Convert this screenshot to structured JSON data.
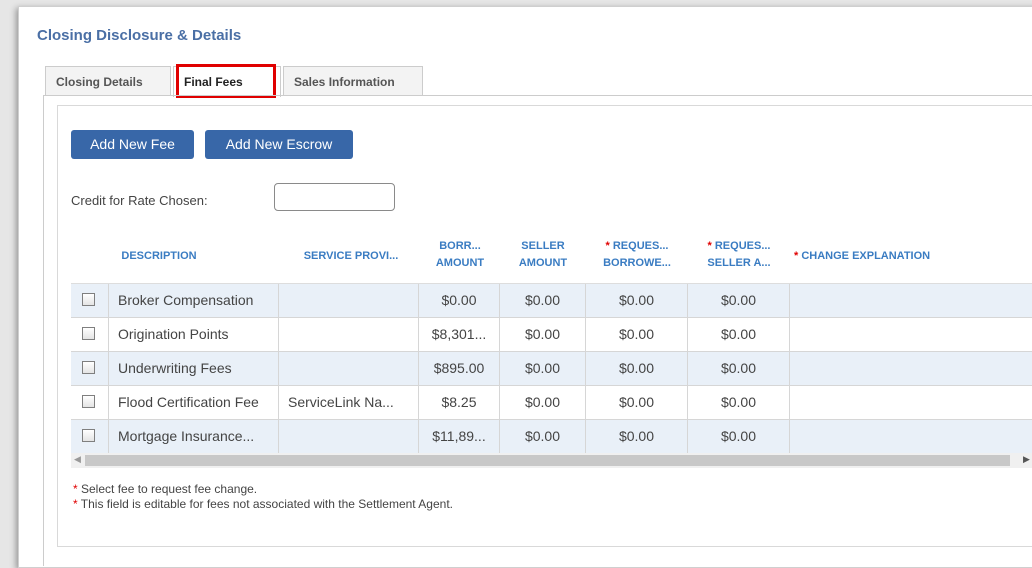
{
  "title": "Closing Disclosure & Details",
  "tabs": [
    {
      "label": "Closing Details"
    },
    {
      "label": "Final Fees"
    },
    {
      "label": "Sales Information"
    }
  ],
  "buttons": {
    "add_fee": "Add New Fee",
    "add_escrow": "Add New Escrow"
  },
  "credit": {
    "label": "Credit for Rate Chosen:",
    "value": ""
  },
  "columns": {
    "description": "DESCRIPTION",
    "service_provider": "SERVICE PROVI...",
    "borrower_amount_1": "BORR...",
    "borrower_amount_2": "AMOUNT",
    "seller_amount_1": "SELLER",
    "seller_amount_2": "AMOUNT",
    "req_borrower_1": "REQUES...",
    "req_borrower_2": "BORROWE...",
    "req_seller_1": "REQUES...",
    "req_seller_2": "SELLER A...",
    "change_explanation": "CHANGE EXPLANATION",
    "required_mark": "*"
  },
  "rows": [
    {
      "description": "Broker Compensation",
      "provider": "",
      "borrower": "$0.00",
      "seller": "$0.00",
      "req_borrower": "$0.00",
      "req_seller": "$0.00",
      "explanation": ""
    },
    {
      "description": "Origination Points",
      "provider": "",
      "borrower": "$8,301...",
      "seller": "$0.00",
      "req_borrower": "$0.00",
      "req_seller": "$0.00",
      "explanation": ""
    },
    {
      "description": "Underwriting Fees",
      "provider": "",
      "borrower": "$895.00",
      "seller": "$0.00",
      "req_borrower": "$0.00",
      "req_seller": "$0.00",
      "explanation": ""
    },
    {
      "description": "Flood Certification Fee",
      "provider": "ServiceLink Na...",
      "borrower": "$8.25",
      "seller": "$0.00",
      "req_borrower": "$0.00",
      "req_seller": "$0.00",
      "explanation": ""
    },
    {
      "description": "Mortgage Insurance...",
      "provider": "",
      "borrower": "$11,89...",
      "seller": "$0.00",
      "req_borrower": "$0.00",
      "req_seller": "$0.00",
      "explanation": ""
    }
  ],
  "notes": [
    {
      "mark": "*",
      "text": " Select fee to request fee change."
    },
    {
      "mark": "*",
      "text": " This field is editable for fees not associated with the Settlement Agent."
    }
  ],
  "colors": {
    "accent": "#3867a8",
    "header_text": "#3a7cc2",
    "required": "#e00000",
    "highlight": "#e00000",
    "row_alt": "#e9f0f8"
  }
}
